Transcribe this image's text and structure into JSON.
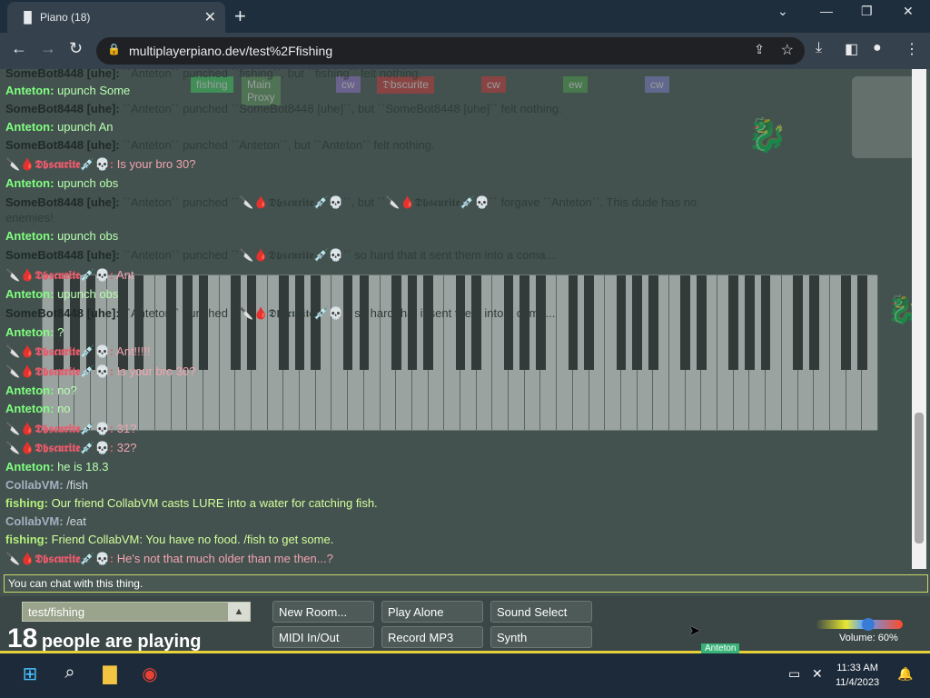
{
  "browser": {
    "tab_title": "Piano (18)",
    "tab_icon": "piano-icon",
    "url": "multiplayerpiano.dev/test%2Ffishing"
  },
  "ghost_tags": [
    "fishing",
    "Main Proxy",
    "cw",
    "𝔇bscurite",
    "cw",
    "ew",
    "cw"
  ],
  "chat": [
    {
      "name": "SomeBot8448 [uhe]:",
      "text": "``Anteton`` punched ``fishing``, but ``fishing`` felt nothing.",
      "k": "bot"
    },
    {
      "name": "Anteton:",
      "text": "upunch Some",
      "k": "ant"
    },
    {
      "name": "SomeBot8448 [uhe]:",
      "text": "``Anteton`` punched ``SomeBot8448 [uhe]``, but ``SomeBot8448 [uhe]`` felt nothing.",
      "k": "bot"
    },
    {
      "name": "Anteton:",
      "text": "upunch An",
      "k": "ant"
    },
    {
      "name": "SomeBot8448 [uhe]:",
      "text": "``Anteton`` punched ``Anteton``, but ``Anteton`` felt nothing.",
      "k": "bot"
    },
    {
      "name": "🔪🩸𝕯𝖇𝖘𝖈𝖚𝖗𝖎𝖙𝖊💉💀:",
      "text": "Is your bro 30?",
      "k": "obs"
    },
    {
      "name": "Anteton:",
      "text": "upunch obs",
      "k": "ant"
    },
    {
      "name": "SomeBot8448 [uhe]:",
      "text": "``Anteton`` punched ``🔪🩸𝕯𝖇𝖘𝖈𝖚𝖗𝖎𝖙𝖊💉💀``, but ``🔪🩸𝕯𝖇𝖘𝖈𝖚𝖗𝖎𝖙𝖊💉💀`` forgave ``Anteton``. This dude has no",
      "k": "bot"
    },
    {
      "name": "",
      "text": "enemies!",
      "k": "bot"
    },
    {
      "name": "Anteton:",
      "text": "upunch obs",
      "k": "ant"
    },
    {
      "name": "SomeBot8448 [uhe]:",
      "text": "``Anteton`` punched ``🔪🩸𝕯𝖇𝖘𝖈𝖚𝖗𝖎𝖙𝖊💉💀`` so hard that it sent them into a coma...",
      "k": "bot"
    },
    {
      "name": "🔪🩸𝕯𝖇𝖘𝖈𝖚𝖗𝖎𝖙𝖊💉💀:",
      "text": "Ant",
      "k": "obs"
    },
    {
      "name": "Anteton:",
      "text": "upunch obs",
      "k": "ant"
    },
    {
      "name": "SomeBot8448 [uhe]:",
      "text": "``Anteton`` punched ``🔪🩸𝕯𝖇𝖘𝖈𝖚𝖗𝖎𝖙𝖊💉💀`` so hard that it sent them into a coma...",
      "k": "bot"
    },
    {
      "name": "Anteton:",
      "text": "?",
      "k": "ant"
    },
    {
      "name": "🔪🩸𝕯𝖇𝖘𝖈𝖚𝖗𝖎𝖙𝖊💉💀:",
      "text": "Ant!!!!!",
      "k": "obs"
    },
    {
      "name": "🔪🩸𝕯𝖇𝖘𝖈𝖚𝖗𝖎𝖙𝖊💉💀:",
      "text": "Is your bro 30?",
      "k": "obs"
    },
    {
      "name": "Anteton:",
      "text": "no?",
      "k": "ant"
    },
    {
      "name": "Anteton:",
      "text": "no",
      "k": "ant"
    },
    {
      "name": "🔪🩸𝕯𝖇𝖘𝖈𝖚𝖗𝖎𝖙𝖊💉💀:",
      "text": "31?",
      "k": "obs"
    },
    {
      "name": "🔪🩸𝕯𝖇𝖘𝖈𝖚𝖗𝖎𝖙𝖊💉💀:",
      "text": "32?",
      "k": "obs"
    },
    {
      "name": "Anteton:",
      "text": "he is 18.3",
      "k": "ant"
    },
    {
      "name": "CollabVM:",
      "text": "/fish",
      "k": "cv"
    },
    {
      "name": "fishing:",
      "text": "Our friend CollabVM casts LURE into a water for catching fish.",
      "k": "fish"
    },
    {
      "name": "CollabVM:",
      "text": "/eat",
      "k": "cv"
    },
    {
      "name": "fishing:",
      "text": "Friend CollabVM: You have no food. /fish to get some.",
      "k": "fish"
    },
    {
      "name": "🔪🩸𝕯𝖇𝖘𝖈𝖚𝖗𝖎𝖙𝖊💉💀:",
      "text": "He's not that much older than me then...?",
      "k": "obs"
    }
  ],
  "chat_input_placeholder": "You can chat with this thing.",
  "room_name": "test/fishing",
  "people_count": "18",
  "people_label": "people are playing",
  "buttons": {
    "new_room": "New Room...",
    "play_alone": "Play Alone",
    "sound_select": "Sound Select",
    "midi": "MIDI In/Out",
    "record": "Record MP3",
    "synth": "Synth"
  },
  "volume": {
    "label": "Volume: 60%",
    "level": 0.6
  },
  "cursor_tag": "Anteton",
  "clock": {
    "time": "11:33 AM",
    "date": "11/4/2023"
  }
}
